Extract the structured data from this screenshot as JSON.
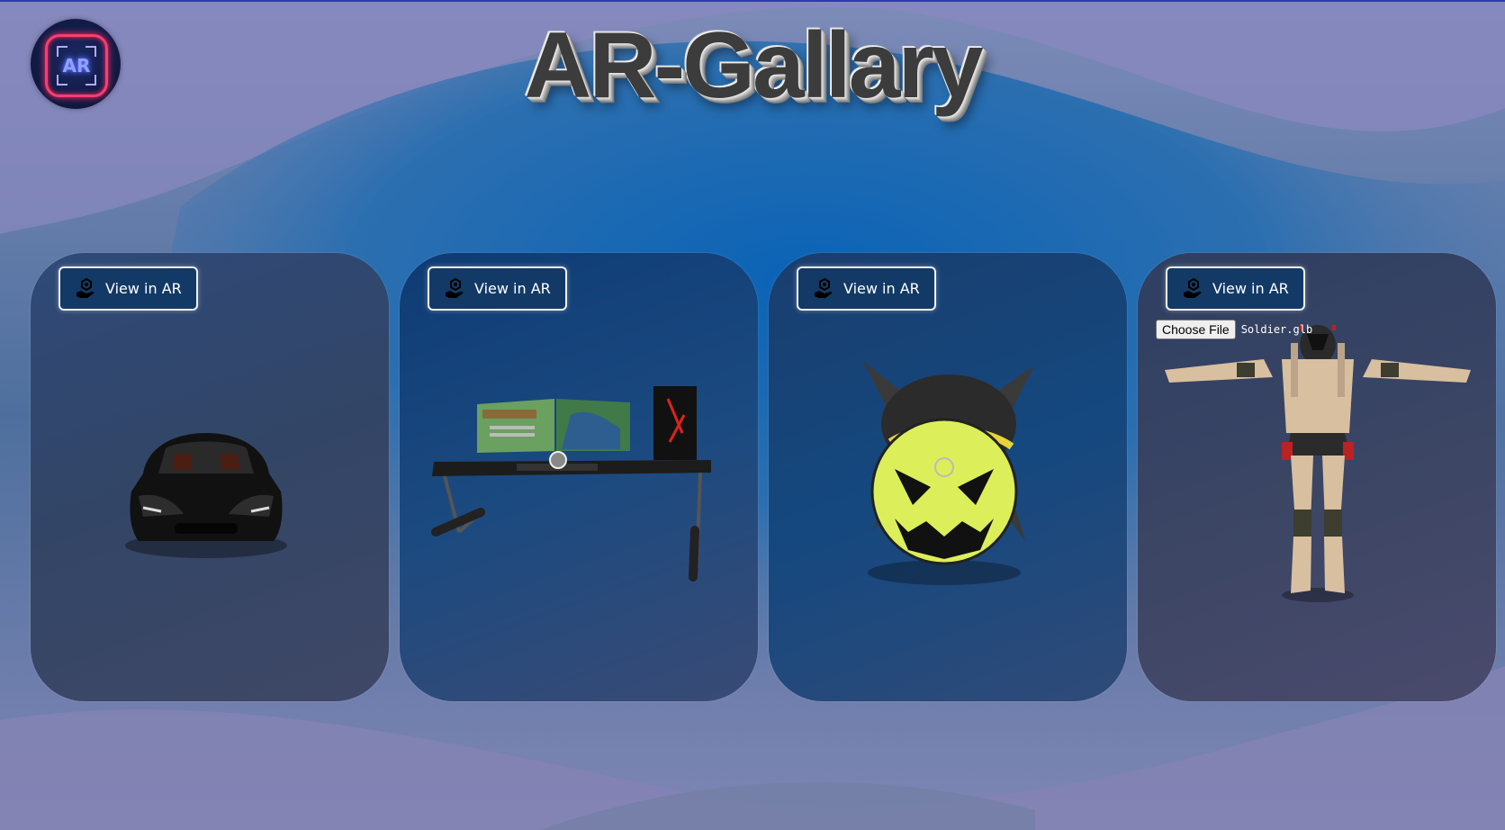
{
  "page": {
    "title": "AR-Gallary",
    "logo_text": "AR"
  },
  "cards": [
    {
      "button_label": "View in AR",
      "button_icon": "hand-ar-icon",
      "model": "black-sports-car"
    },
    {
      "button_label": "View in AR",
      "button_icon": "hand-ar-icon",
      "model": "gaming-desk-setup"
    },
    {
      "button_label": "View in AR",
      "button_icon": "hand-ar-icon",
      "model": "pumpkin-face-bomb"
    },
    {
      "button_label": "View in AR",
      "button_icon": "hand-ar-icon",
      "model": "soldier",
      "file_input": {
        "button_label": "Choose File",
        "file_name": "Soldier.glb"
      }
    }
  ],
  "colors": {
    "background_blue": "#0b66b8",
    "background_lavender": "#8a88bf",
    "button_bg": "#133a66",
    "logo_neon_pink": "#ff3d6e",
    "logo_neon_blue": "#8fa0ff"
  }
}
